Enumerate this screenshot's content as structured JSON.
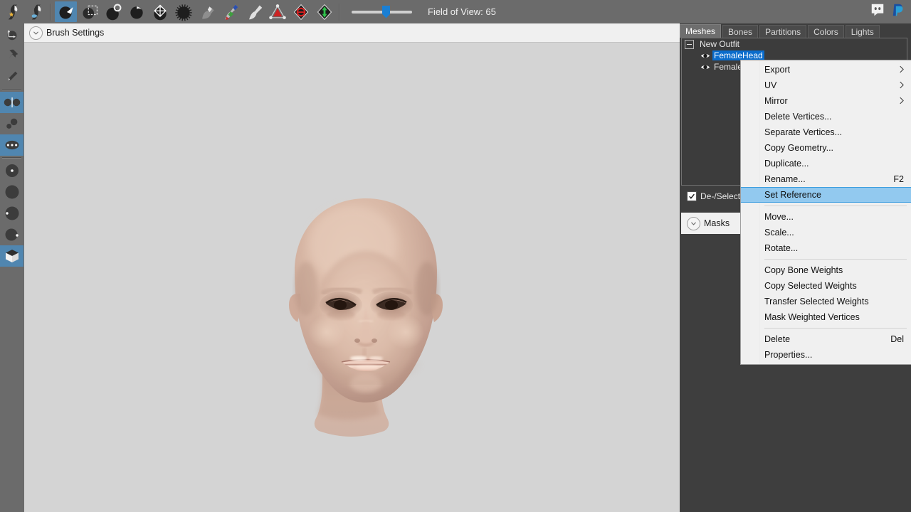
{
  "toolbar": {
    "tools": [
      {
        "name": "mesh-star-icon",
        "active": false
      },
      {
        "name": "mesh-water-icon",
        "active": false
      },
      {
        "name": "brush-inflate-icon",
        "active": true
      },
      {
        "name": "brush-marquee-icon",
        "active": false
      },
      {
        "name": "brush-deflate-icon",
        "active": false
      },
      {
        "name": "brush-crease-icon",
        "active": false
      },
      {
        "name": "brush-move-icon",
        "active": false
      },
      {
        "name": "brush-smooth-icon",
        "active": false
      },
      {
        "name": "brush-mask-icon",
        "active": false
      },
      {
        "name": "brush-weight-paint-icon",
        "active": false
      },
      {
        "name": "brush-color-paint-icon",
        "active": false
      },
      {
        "name": "vertex-edit-icon",
        "active": false
      },
      {
        "name": "mirror-x-icon",
        "active": false
      },
      {
        "name": "mirror-y-icon",
        "active": false
      }
    ],
    "fov_label": "Field of View: 65",
    "fov_value": 65,
    "links": [
      {
        "name": "discord-icon"
      },
      {
        "name": "paypal-icon"
      }
    ]
  },
  "left_tools": [
    {
      "name": "tool-transform-pivot-icon",
      "active": false
    },
    {
      "name": "tool-pin-icon",
      "active": false
    },
    {
      "name": "tool-pencil-icon",
      "active": false
    },
    {
      "name": "tool-symmetry-icon",
      "active": true
    },
    {
      "name": "tool-connected-only-icon",
      "active": false
    },
    {
      "name": "tool-x-mirror-icon",
      "active": true
    },
    {
      "name": "tool-brush-center-icon",
      "active": false
    },
    {
      "name": "tool-brush-solid-icon",
      "active": false
    },
    {
      "name": "tool-brush-offset-left-icon",
      "active": false
    },
    {
      "name": "tool-brush-offset-right-icon",
      "active": false
    },
    {
      "name": "tool-cube-view-icon",
      "active": true
    }
  ],
  "brush_settings": {
    "label": "Brush Settings",
    "collapse_icon": "chevron-down-icon"
  },
  "viewport": {
    "name": "3d-viewport",
    "background_color": "#d4d4d4",
    "model": "FemaleHead"
  },
  "right_panel": {
    "tabs": [
      {
        "label": "Meshes",
        "active": true
      },
      {
        "label": "Bones",
        "active": false
      },
      {
        "label": "Partitions",
        "active": false
      },
      {
        "label": "Colors",
        "active": false
      },
      {
        "label": "Lights",
        "active": false
      }
    ],
    "tree": {
      "root": {
        "label": "New Outfit",
        "expander": "minus"
      },
      "children": [
        {
          "label": "FemaleHead",
          "selected": true,
          "visibility_icon": "eye-icon"
        },
        {
          "label": "FemaleBody",
          "selected": false,
          "visibility_icon": "eye-icon"
        }
      ]
    },
    "deselect": {
      "label": "De-/Select S",
      "checked": true
    },
    "masks": {
      "label": "Masks",
      "collapse_icon": "chevron-down-icon"
    }
  },
  "context_menu": {
    "items": [
      {
        "label": "Export",
        "submenu": true,
        "shortcut": "",
        "highlight": false,
        "separator_after": false
      },
      {
        "label": "UV",
        "submenu": true,
        "shortcut": "",
        "highlight": false,
        "separator_after": false
      },
      {
        "label": "Mirror",
        "submenu": true,
        "shortcut": "",
        "highlight": false,
        "separator_after": false
      },
      {
        "label": "Delete Vertices...",
        "submenu": false,
        "shortcut": "",
        "highlight": false,
        "separator_after": false
      },
      {
        "label": "Separate Vertices...",
        "submenu": false,
        "shortcut": "",
        "highlight": false,
        "separator_after": false
      },
      {
        "label": "Copy Geometry...",
        "submenu": false,
        "shortcut": "",
        "highlight": false,
        "separator_after": false
      },
      {
        "label": "Duplicate...",
        "submenu": false,
        "shortcut": "",
        "highlight": false,
        "separator_after": false
      },
      {
        "label": "Rename...",
        "submenu": false,
        "shortcut": "F2",
        "highlight": false,
        "separator_after": false
      },
      {
        "label": "Set Reference",
        "submenu": false,
        "shortcut": "",
        "highlight": true,
        "separator_after": true
      },
      {
        "label": "Move...",
        "submenu": false,
        "shortcut": "",
        "highlight": false,
        "separator_after": false
      },
      {
        "label": "Scale...",
        "submenu": false,
        "shortcut": "",
        "highlight": false,
        "separator_after": false
      },
      {
        "label": "Rotate...",
        "submenu": false,
        "shortcut": "",
        "highlight": false,
        "separator_after": true
      },
      {
        "label": "Copy Bone Weights",
        "submenu": false,
        "shortcut": "",
        "highlight": false,
        "separator_after": false
      },
      {
        "label": "Copy Selected Weights",
        "submenu": false,
        "shortcut": "",
        "highlight": false,
        "separator_after": false
      },
      {
        "label": "Transfer Selected Weights",
        "submenu": false,
        "shortcut": "",
        "highlight": false,
        "separator_after": false
      },
      {
        "label": "Mask Weighted Vertices",
        "submenu": false,
        "shortcut": "",
        "highlight": false,
        "separator_after": true
      },
      {
        "label": "Delete",
        "submenu": false,
        "shortcut": "Del",
        "highlight": false,
        "separator_after": false
      },
      {
        "label": "Properties...",
        "submenu": false,
        "shortcut": "",
        "highlight": false,
        "separator_after": false
      }
    ],
    "highlight_color": "#92c9ef"
  }
}
